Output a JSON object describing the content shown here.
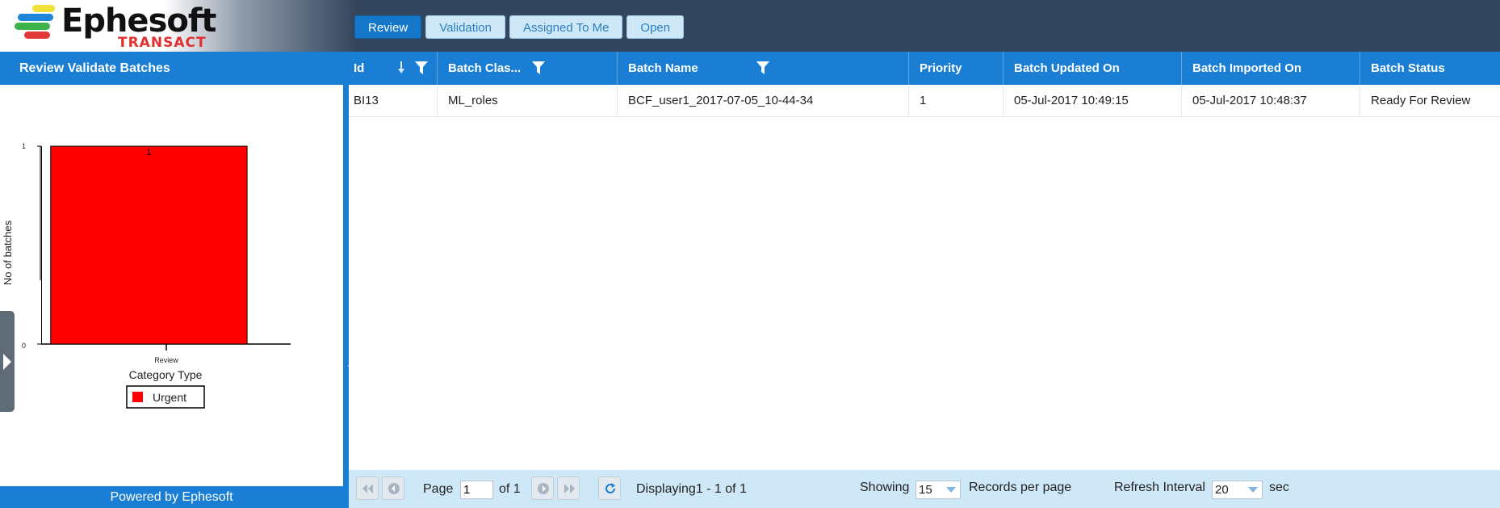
{
  "brand": {
    "name": "Ephesoft",
    "product": "TRANSACT"
  },
  "tabs": [
    {
      "label": "Review",
      "active": true
    },
    {
      "label": "Validation",
      "active": false
    },
    {
      "label": "Assigned To Me",
      "active": false
    },
    {
      "label": "Open",
      "active": false
    }
  ],
  "left_panel": {
    "title": "Review Validate Batches",
    "footer": "Powered by Ephesoft"
  },
  "chart_data": {
    "type": "bar",
    "categories": [
      "Review"
    ],
    "series": [
      {
        "name": "Urgent",
        "values": [
          1
        ],
        "color": "#ff0000"
      }
    ],
    "data_labels": [
      "1"
    ],
    "ylabel": "No of batches",
    "legend_title": "Category Type",
    "ylim": [
      0,
      1
    ],
    "yticks": [
      "0",
      "1"
    ],
    "grid": false,
    "legend_position": "bottom"
  },
  "grid": {
    "columns": [
      {
        "label": "Id",
        "sortable": true,
        "filter": true
      },
      {
        "label": "Batch Clas...",
        "sortable": false,
        "filter": true
      },
      {
        "label": "Batch Name",
        "sortable": false,
        "filter": true
      },
      {
        "label": "Priority",
        "sortable": false,
        "filter": false
      },
      {
        "label": "Batch Updated On",
        "sortable": false,
        "filter": false
      },
      {
        "label": "Batch Imported On",
        "sortable": false,
        "filter": false
      },
      {
        "label": "Batch Status",
        "sortable": false,
        "filter": false
      }
    ],
    "rows": [
      [
        "BI13",
        "ML_roles",
        "BCF_user1_2017-07-05_10-44-34",
        "1",
        "05-Jul-2017 10:49:15",
        "05-Jul-2017 10:48:37",
        "Ready For Review"
      ]
    ]
  },
  "pager": {
    "page_label": "Page",
    "page_value": "1",
    "of_label": "of 1",
    "displaying": "Displaying1 - 1 of 1",
    "showing_label": "Showing",
    "records_value": "15",
    "records_label": "Records per page",
    "refresh_label": "Refresh Interval",
    "refresh_value": "20",
    "sec_label": "sec"
  },
  "colors": {
    "header_bg": "#34465d",
    "accent_blue": "#1a7fd4",
    "pager_bg": "#cfe8f8",
    "bar_red": "#ff0000"
  }
}
